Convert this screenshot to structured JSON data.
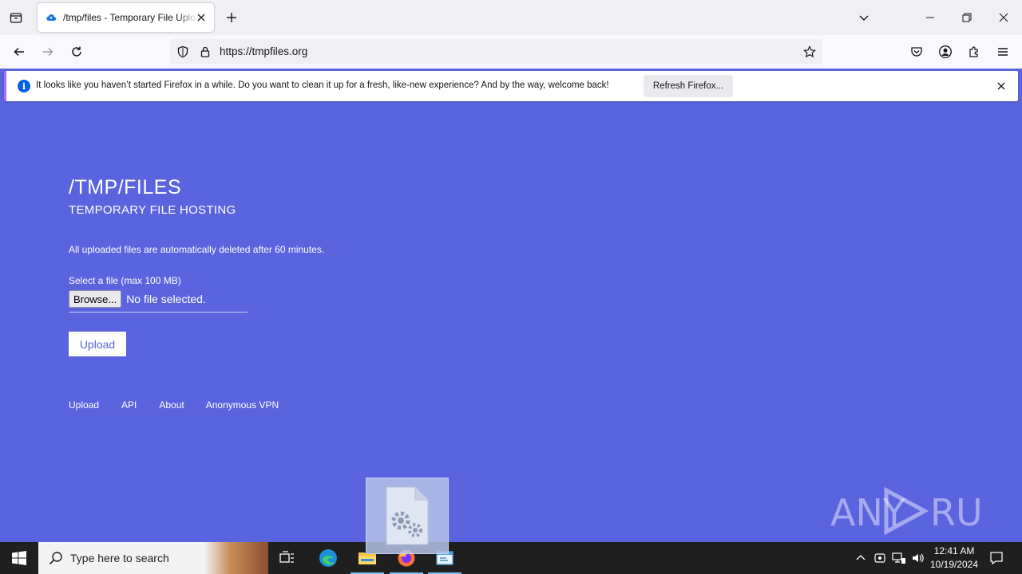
{
  "browser": {
    "tab": {
      "title": "/tmp/files - Temporary File Upload"
    },
    "url": "https://tmpfiles.org",
    "notification": {
      "message": "It looks like you haven’t started Firefox in a while. Do you want to clean it up for a fresh, like-new experience? And by the way, welcome back!",
      "button_label": "Refresh Firefox..."
    }
  },
  "page": {
    "title": "/TMP/FILES",
    "subtitle": "TEMPORARY FILE HOSTING",
    "notice": "All uploaded files are automatically deleted after 60 minutes.",
    "file_label": "Select a file (max 100 MB)",
    "browse_label": "Browse...",
    "file_status": "No file selected.",
    "upload_label": "Upload",
    "footer_links": [
      "Upload",
      "API",
      "About",
      "Anonymous VPN"
    ]
  },
  "watermark": "ANY RUN",
  "taskbar": {
    "search_placeholder": "Type here to search",
    "clock_time": "12:41 AM",
    "clock_date": "10/19/2024"
  },
  "colors": {
    "page_bg": "#5a64de",
    "accent": "#0060df",
    "notif_border": "#a66efd"
  }
}
